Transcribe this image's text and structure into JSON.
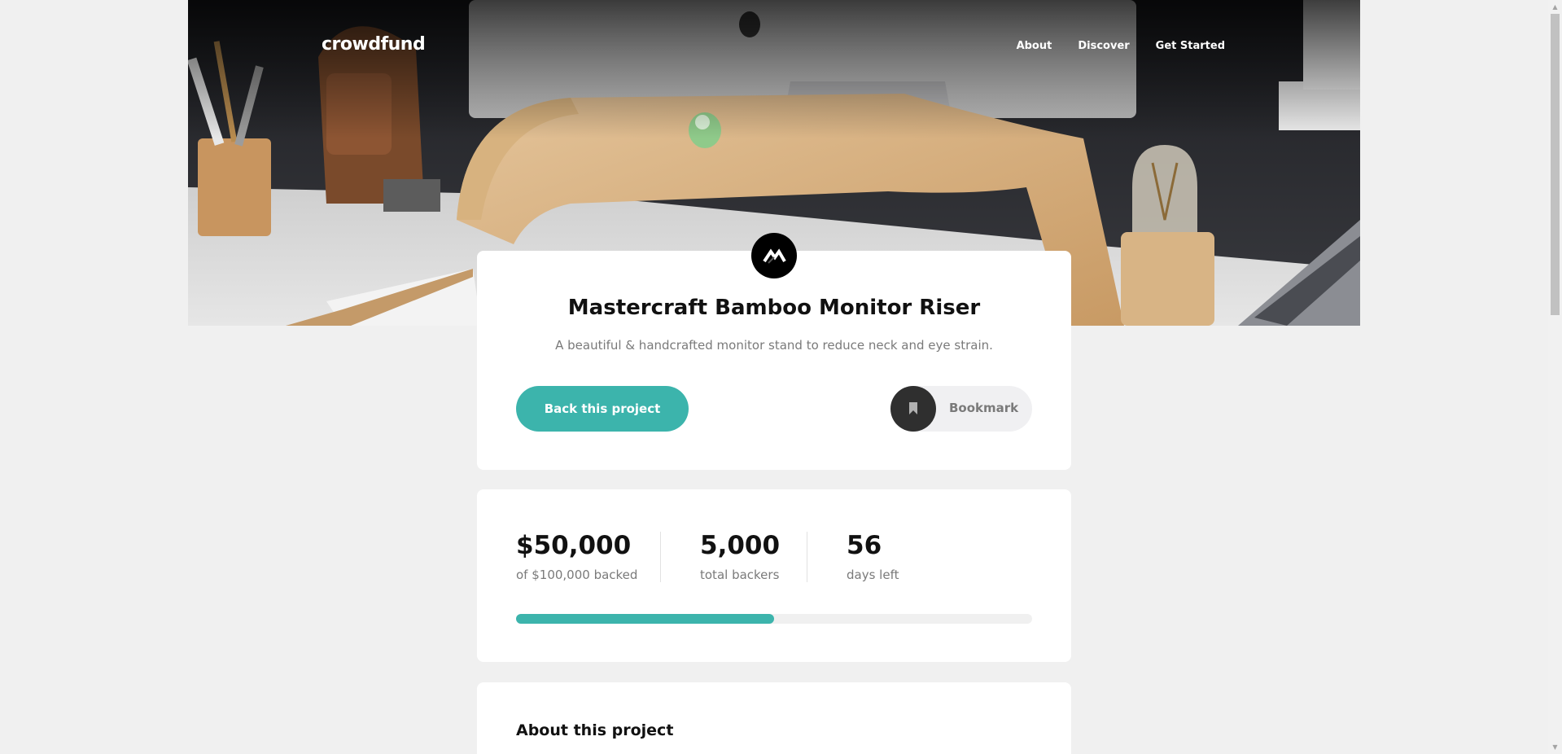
{
  "nav": {
    "logo": "crowdfund",
    "links": [
      "About",
      "Discover",
      "Get Started"
    ]
  },
  "project": {
    "logo_icon": "mastercraft-m-icon",
    "title": "Mastercraft Bamboo Monitor Riser",
    "description": "A beautiful & handcrafted monitor stand to reduce neck and eye strain.",
    "back_label": "Back this project",
    "bookmark_label": "Bookmark",
    "bookmark_icon": "bookmark-icon"
  },
  "stats": {
    "backed": {
      "value": "$50,000",
      "label": "of $100,000 backed"
    },
    "backers": {
      "value": "5,000",
      "label": "total backers"
    },
    "days": {
      "value": "56",
      "label": "days left"
    },
    "progress_fraction": 0.5
  },
  "about": {
    "title": "About this project"
  },
  "colors": {
    "accent": "#3cb4ac",
    "background": "#f0f0f0",
    "dark": "#2f2f2f"
  }
}
